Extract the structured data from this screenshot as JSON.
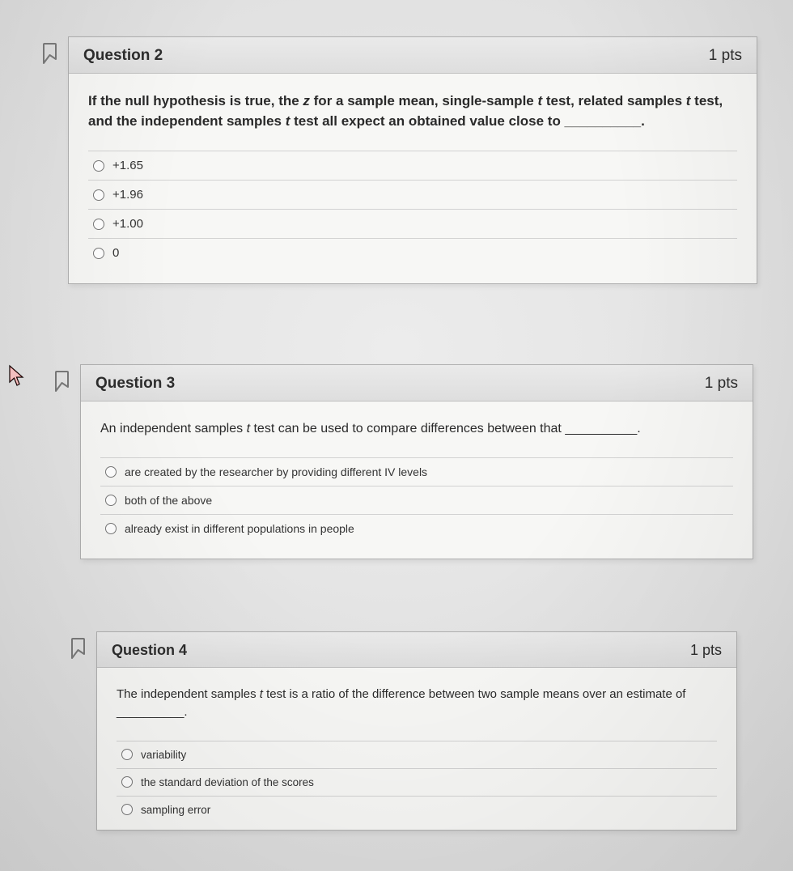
{
  "cursor_name": "pointer-cursor",
  "questions": [
    {
      "title": "Question 2",
      "points": "1 pts",
      "prompt_pre": "If the null hypothesis is true, the ",
      "prompt_z": "z",
      "prompt_mid1": " for a sample mean, single-sample ",
      "prompt_t1": "t",
      "prompt_mid2": " test, related samples ",
      "prompt_t2": "t",
      "prompt_mid3": " test, and the independent samples ",
      "prompt_t3": "t",
      "prompt_post": " test all expect an obtained value close to __________.",
      "options": [
        "+1.65",
        "+1.96",
        "+1.00",
        "0"
      ]
    },
    {
      "title": "Question 3",
      "points": "1 pts",
      "prompt_pre": "An independent samples ",
      "prompt_t1": "t",
      "prompt_post": " test can be used to compare differences between that __________.",
      "options": [
        "are created by the researcher by providing different IV levels",
        "both of the above",
        "already exist in different populations in people"
      ]
    },
    {
      "title": "Question 4",
      "points": "1 pts",
      "prompt_pre": "The independent samples ",
      "prompt_t1": "t",
      "prompt_post": " test is a ratio of the difference between two sample means over an estimate of __________.",
      "options": [
        "variability",
        "the standard deviation of the scores",
        "sampling error"
      ]
    }
  ]
}
